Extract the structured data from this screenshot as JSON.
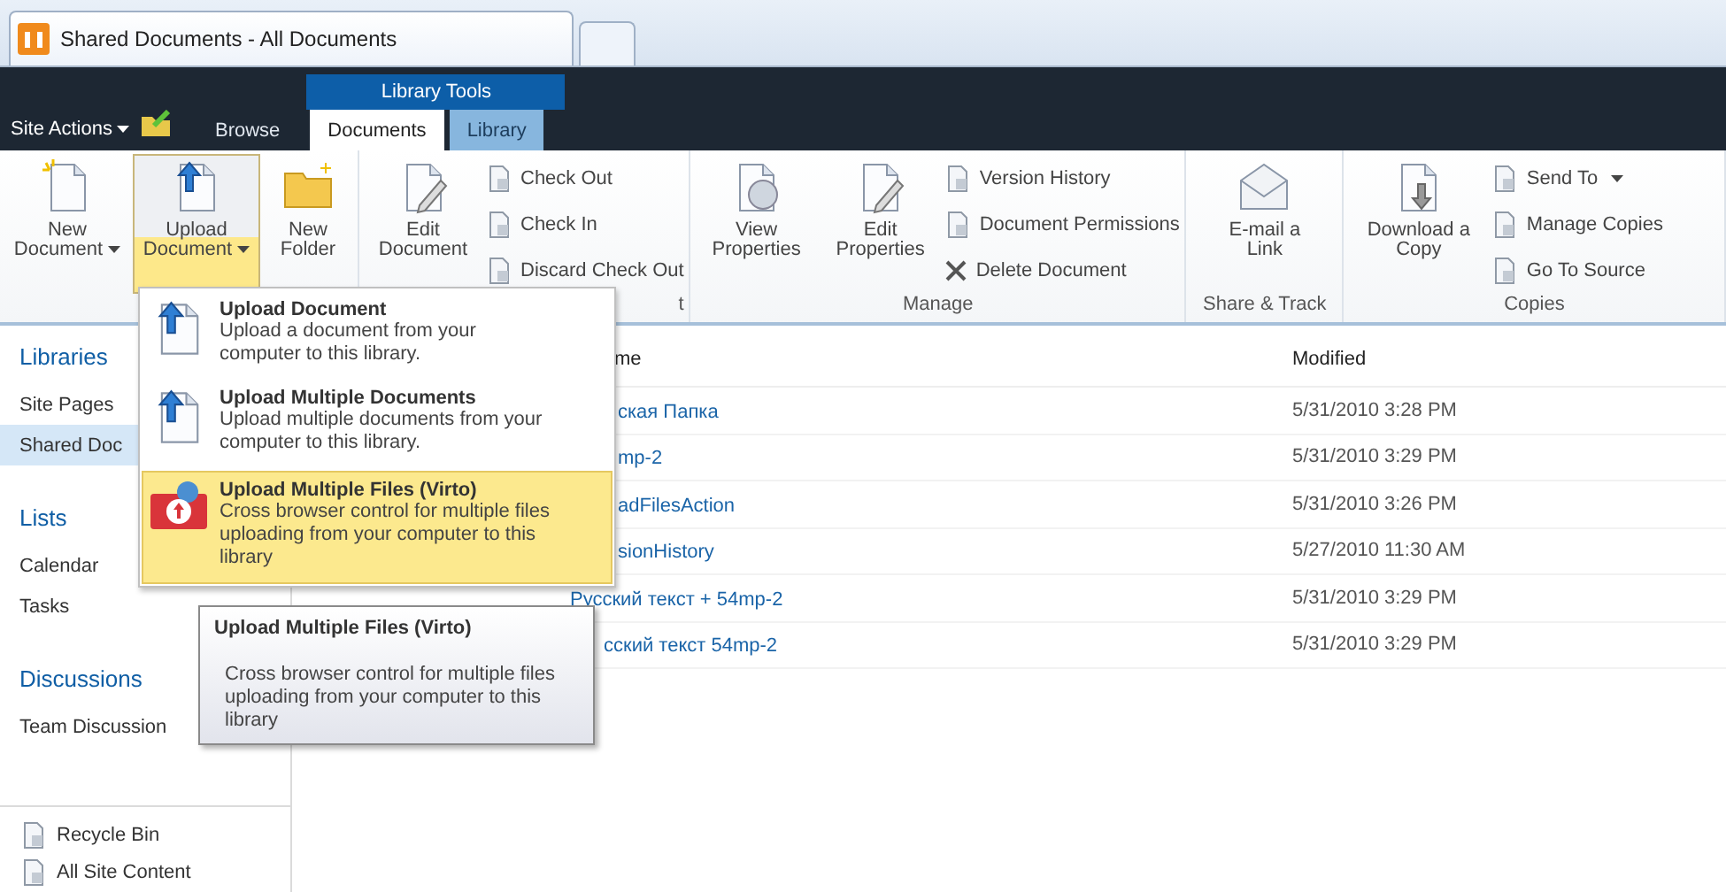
{
  "browser_tab": {
    "title": "Shared Documents - All Documents"
  },
  "top_bar": {
    "site_actions": {
      "label": "Site Actions",
      "caret": true
    },
    "context_label": "Library Tools",
    "tabs": [
      {
        "label": "Browse",
        "selected": false,
        "kind": "plain"
      },
      {
        "label": "Documents",
        "selected": true,
        "kind": "context"
      },
      {
        "label": "Library",
        "selected": false,
        "kind": "context"
      }
    ]
  },
  "ribbon": {
    "groups": [
      {
        "large": [
          {
            "lines": [
              "New",
              "Document"
            ],
            "caret": true,
            "selected": false
          },
          {
            "lines": [
              "Upload",
              "Document"
            ],
            "caret": true,
            "selected": true
          },
          {
            "lines": [
              "New",
              "Folder"
            ],
            "caret": false,
            "selected": false
          }
        ]
      },
      {
        "label": "t",
        "large": [
          {
            "lines": [
              "Edit",
              "Document"
            ],
            "caret": false,
            "selected": false
          }
        ],
        "small": [
          {
            "label": "Check Out",
            "caret": false
          },
          {
            "label": "Check In",
            "caret": false
          },
          {
            "label": "Discard Check Out",
            "caret": false
          }
        ]
      },
      {
        "label": "Manage",
        "large": [
          {
            "lines": [
              "View",
              "Properties"
            ],
            "caret": false,
            "selected": false
          },
          {
            "lines": [
              "Edit",
              "Properties"
            ],
            "caret": false,
            "selected": false
          }
        ],
        "small": [
          {
            "label": "Version History",
            "caret": false
          },
          {
            "label": "Document Permissions",
            "caret": false
          },
          {
            "label": "Delete Document",
            "caret": false
          }
        ]
      },
      {
        "label": "Share & Track",
        "large": [
          {
            "lines": [
              "E-mail a",
              "Link"
            ],
            "caret": false,
            "selected": false
          }
        ]
      },
      {
        "label": "Copies",
        "large": [
          {
            "lines": [
              "Download a",
              "Copy"
            ],
            "caret": false,
            "selected": false
          }
        ],
        "small": [
          {
            "label": "Send To",
            "caret": true
          },
          {
            "label": "Manage Copies",
            "caret": false
          },
          {
            "label": "Go To Source",
            "caret": false
          }
        ]
      }
    ]
  },
  "sidebar": {
    "sections": [
      {
        "heading": "Libraries",
        "items": [
          {
            "label": "Site Pages",
            "selected": false
          },
          {
            "label": "Shared Doc",
            "selected": true
          }
        ]
      },
      {
        "heading": "Lists",
        "items": [
          {
            "label": "Calendar",
            "selected": false
          },
          {
            "label": "Tasks",
            "selected": false
          }
        ]
      },
      {
        "heading": "Discussions",
        "items": [
          {
            "label": "Team Discussion",
            "selected": false
          }
        ]
      }
    ],
    "footer": [
      {
        "label": "Recycle Bin"
      },
      {
        "label": "All Site Content"
      }
    ]
  },
  "table": {
    "columns": [
      "me",
      "Modified"
    ],
    "rows": [
      {
        "name": "ская Папка",
        "modified": "5/31/2010 3:28 PM"
      },
      {
        "name": "mp-2",
        "modified": "5/31/2010 3:29 PM"
      },
      {
        "name": "adFilesAction",
        "modified": "5/31/2010 3:26 PM"
      },
      {
        "name": "sionHistory",
        "modified": "5/27/2010 11:30 AM"
      },
      {
        "name": "Русский текст + 54mp-2",
        "modified": "5/31/2010 3:29 PM"
      },
      {
        "name": "сский текст 54mp-2",
        "modified": "5/31/2010 3:29 PM"
      }
    ]
  },
  "upload_menu": {
    "items": [
      {
        "title": "Upload Document",
        "description": "Upload a document from your computer to this library.",
        "selected": false
      },
      {
        "title": "Upload Multiple Documents",
        "description": "Upload multiple documents from your computer to this library.",
        "selected": false
      },
      {
        "title": "Upload Multiple Files (Virto)",
        "description": "Cross browser control for multiple files uploading from your computer to this library",
        "selected": true
      }
    ]
  },
  "tooltip": {
    "title": "Upload Multiple Files (Virto)",
    "description": "Cross browser control for multiple files uploading from your computer to this library"
  }
}
